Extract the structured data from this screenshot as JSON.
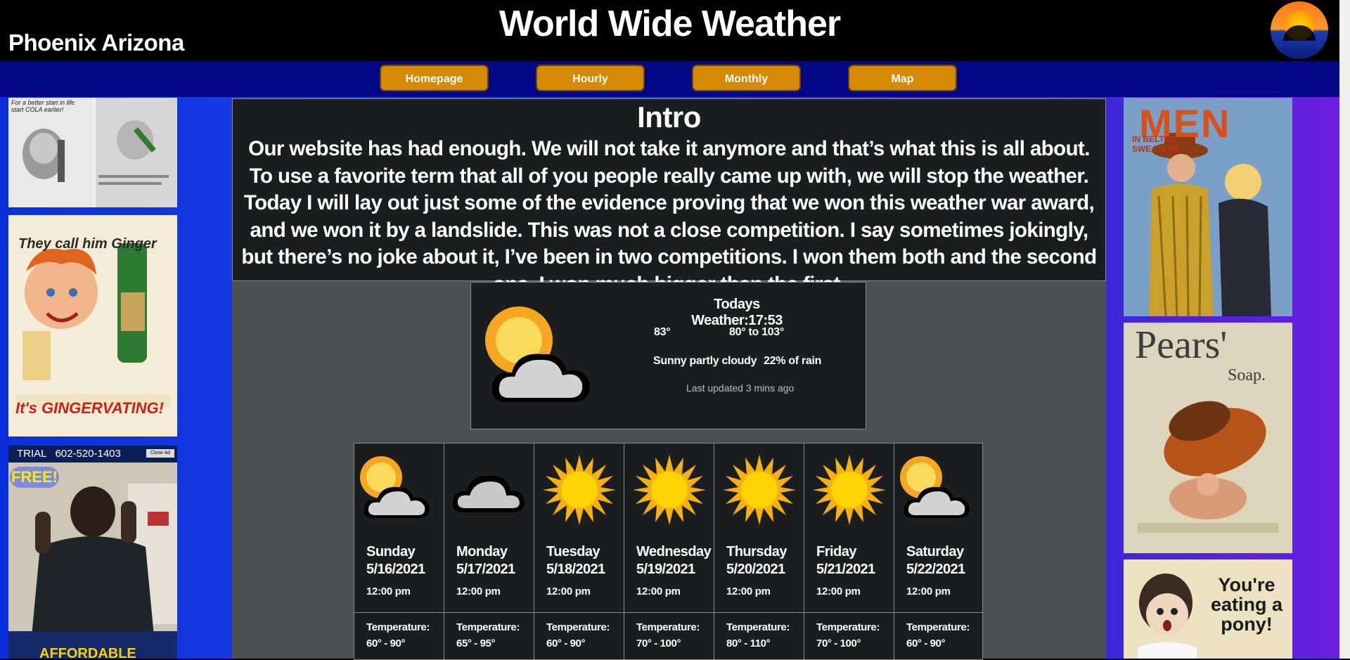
{
  "header": {
    "site_title": "World Wide Weather",
    "location": "Phoenix Arizona",
    "logo_icon": "sunset-logo-icon"
  },
  "nav": {
    "items": [
      {
        "label": "Homepage"
      },
      {
        "label": "Hourly"
      },
      {
        "label": "Monthly"
      },
      {
        "label": "Map"
      }
    ],
    "color": "#d48a06",
    "bar_color": "#010784"
  },
  "ads_left": [
    {
      "name": "cola-baby-ad",
      "text": "For a better start in life start COLA earlier!"
    },
    {
      "name": "ginger-ale-ad",
      "title": "They call him Ginger",
      "footer": "It's GINGERVATING!"
    },
    {
      "name": "trial-video-ad",
      "banner": "TRIAL   602-520-1403",
      "badge": "FREE!",
      "close": "Close Ad",
      "footer": "AFFORDABLE"
    }
  ],
  "ads_right": [
    {
      "name": "men-sweaters-ad",
      "title": "MEN",
      "subtitle": "IN BELTED SWEATERS"
    },
    {
      "name": "pears-soap-ad",
      "title": "Pears'",
      "subtitle": "Soap."
    },
    {
      "name": "eating-pony-ad",
      "text": "You're eating a pony!"
    }
  ],
  "intro": {
    "heading": "Intro",
    "text": "Our website has had enough. We will not take it anymore and that’s what this is all about. To use a favorite term that all of you people really came up with, we will stop the weather. Today I will lay out just some of the evidence proving that we won this weather war award, and we won it by a landslide. This was not a close competition. I say sometimes jokingly, but there’s no joke about it, I’ve been in two competitions. I won them both and the second one, I won much bigger than the first."
  },
  "today": {
    "title": "Todays Weather:17:53",
    "temp": "83°",
    "range": "80° to 103°",
    "condition": "Sunny partly cloudy",
    "rain": "22% of rain",
    "updated": "Last updated 3 mins ago",
    "icon": "partly-cloudy-icon"
  },
  "forecast": [
    {
      "day": "Sunday",
      "date": "5/16/2021",
      "time": "12:00 pm",
      "label": "Temperature:",
      "range": "60° - 90°",
      "icon": "partly-cloudy"
    },
    {
      "day": "Monday",
      "date": "5/17/2021",
      "time": "12:00 pm",
      "label": "Temperature:",
      "range": "65° - 95°",
      "icon": "cloudy"
    },
    {
      "day": "Tuesday",
      "date": "5/18/2021",
      "time": "12:00 pm",
      "label": "Temperature:",
      "range": "60° - 90°",
      "icon": "sunny"
    },
    {
      "day": "Wednesday",
      "date": "5/19/2021",
      "time": "12:00 pm",
      "label": "Temperature:",
      "range": "70° - 100°",
      "icon": "sunny"
    },
    {
      "day": "Thursday",
      "date": "5/20/2021",
      "time": "12:00 pm",
      "label": "Temperature:",
      "range": "80° - 110°",
      "icon": "sunny"
    },
    {
      "day": "Friday",
      "date": "5/21/2021",
      "time": "12:00 pm",
      "label": "Temperature:",
      "range": "70° - 100°",
      "icon": "sunny"
    },
    {
      "day": "Saturday",
      "date": "5/22/2021",
      "time": "12:00 pm",
      "label": "Temperature:",
      "range": "60° - 90°",
      "icon": "partly-cloudy"
    }
  ]
}
